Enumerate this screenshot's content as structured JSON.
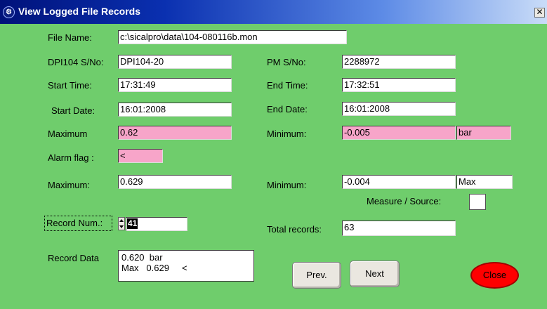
{
  "window": {
    "title": "View Logged File Records",
    "title_icon": "ge-logo-icon",
    "close_glyph": "✕"
  },
  "labels": {
    "file_name": "File Name:",
    "dpi_sn": "DPI104 S/No:",
    "pm_sn": "PM S/No:",
    "start_time": "Start Time:",
    "end_time": "End Time:",
    "start_date": "Start Date:",
    "end_date": "End Date:",
    "maximum1": "Maximum",
    "minimum1": "Minimum:",
    "alarm_flag": "Alarm flag :",
    "maximum2": "Maximum:",
    "minimum2": "Minimum:",
    "measure_source": "Measure / Source:",
    "record_num": "Record Num.:",
    "total_records": "Total records:",
    "record_data": "Record Data"
  },
  "values": {
    "file_name": "c:\\sicalpro\\data\\104-080116b.mon",
    "dpi_sn": "DPI104-20",
    "pm_sn": "2288972",
    "start_time": "17:31:49",
    "end_time": "17:32:51",
    "start_date": "16:01:2008",
    "end_date": "16:01:2008",
    "maximum1": "0.62",
    "minimum1": "-0.005",
    "unit1": "bar",
    "alarm_flag": "<",
    "maximum2": "0.629",
    "minimum2": "-0.004",
    "mode2": "Max",
    "record_num": "41",
    "total_records": "63",
    "record_data_line1": "0.620  bar",
    "record_data_line2": "Max   0.629     <"
  },
  "buttons": {
    "prev": "Prev.",
    "next": "Next",
    "close": "Close"
  },
  "colors": {
    "window_bg": "#6fcd6c",
    "alarm_field": "#f7a5c9",
    "close_button": "#ff0000"
  }
}
